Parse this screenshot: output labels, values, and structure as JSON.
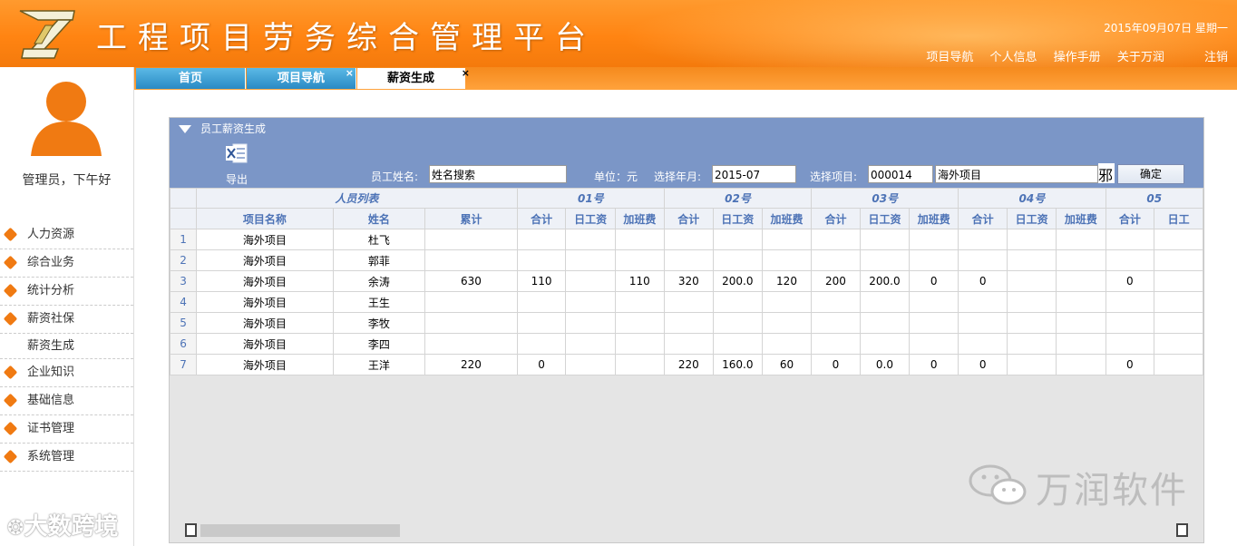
{
  "header": {
    "title": "工程项目劳务综合管理平台",
    "date": "2015年09月07日 星期一",
    "links": [
      "项目导航",
      "个人信息",
      "操作手册",
      "关于万润"
    ],
    "logout": "注销"
  },
  "tabs": [
    {
      "label": "首页",
      "closable": false
    },
    {
      "label": "项目导航",
      "closable": true
    },
    {
      "label": "薪资生成",
      "closable": true,
      "active": true
    }
  ],
  "close_glyph": "×",
  "sidebar": {
    "greeting": "管理员，下午好",
    "items": [
      {
        "label": "人力资源"
      },
      {
        "label": "综合业务"
      },
      {
        "label": "统计分析"
      },
      {
        "label": "薪资社保"
      },
      {
        "label": "薪资生成",
        "sub": true
      },
      {
        "label": "企业知识"
      },
      {
        "label": "基础信息"
      },
      {
        "label": "证书管理"
      },
      {
        "label": "系统管理"
      }
    ]
  },
  "panel": {
    "title": "员工薪资生成",
    "export_label": "导出",
    "name_label": "员工姓名:",
    "name_value": "姓名搜索",
    "unit_label": "单位：元",
    "month_label": "选择年月:",
    "month_value": "2015-07",
    "project_label": "选择项目:",
    "project_code": "000014",
    "project_name": "海外项目",
    "cut_char": "邪",
    "confirm_label": "确定"
  },
  "table": {
    "group_headers": [
      "人员列表",
      "01号",
      "02号",
      "03号",
      "04号",
      "05"
    ],
    "col_headers": [
      "项目名称",
      "姓名",
      "累计",
      "合计",
      "日工资",
      "加班费",
      "合计",
      "日工资",
      "加班费",
      "合计",
      "日工资",
      "加班费",
      "合计",
      "日工资",
      "加班费",
      "合计",
      "日工"
    ],
    "rows": [
      [
        "1",
        "海外项目",
        "杜飞",
        "",
        "",
        "",
        "",
        "",
        "",
        "",
        "",
        "",
        "",
        "",
        "",
        "",
        "",
        ""
      ],
      [
        "2",
        "海外项目",
        "郭菲",
        "",
        "",
        "",
        "",
        "",
        "",
        "",
        "",
        "",
        "",
        "",
        "",
        "",
        "",
        ""
      ],
      [
        "3",
        "海外项目",
        "余涛",
        "630",
        "110",
        "",
        "110",
        "320",
        "200.0",
        "120",
        "200",
        "200.0",
        "0",
        "0",
        "",
        "",
        "0",
        ""
      ],
      [
        "4",
        "海外项目",
        "王生",
        "",
        "",
        "",
        "",
        "",
        "",
        "",
        "",
        "",
        "",
        "",
        "",
        "",
        "",
        ""
      ],
      [
        "5",
        "海外项目",
        "李牧",
        "",
        "",
        "",
        "",
        "",
        "",
        "",
        "",
        "",
        "",
        "",
        "",
        "",
        "",
        ""
      ],
      [
        "6",
        "海外项目",
        "李四",
        "",
        "",
        "",
        "",
        "",
        "",
        "",
        "",
        "",
        "",
        "",
        "",
        "",
        "",
        ""
      ],
      [
        "7",
        "海外项目",
        "王洋",
        "220",
        "0",
        "",
        "",
        "220",
        "160.0",
        "60",
        "0",
        "0.0",
        "0",
        "0",
        "",
        "",
        "0",
        ""
      ]
    ]
  },
  "watermarks": {
    "right": "万润软件",
    "left": "大数跨境"
  },
  "colors": {
    "header_orange": "#ff8412",
    "tab_blue": "#2a8ac4",
    "panel_head": "#7b96c7",
    "grid_header_text": "#4d73b6",
    "menu_tag": "#f07a12"
  }
}
